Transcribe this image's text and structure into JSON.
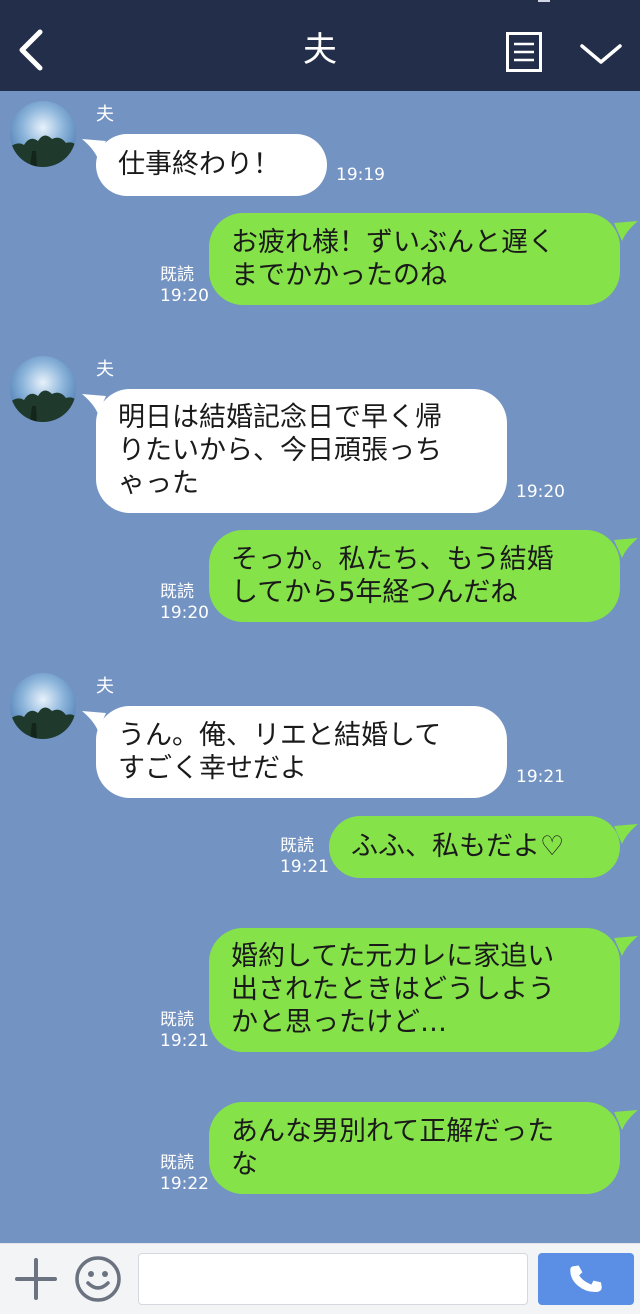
{
  "header": {
    "title": "夫",
    "icons": {
      "back": "chevron-left-icon",
      "menu": "menu-list-icon",
      "more": "chevron-down-icon"
    }
  },
  "contact": {
    "name": "夫",
    "avatar": "avatar-tree-sky-photo"
  },
  "messages": [
    {
      "side": "in",
      "sender": "夫",
      "text": "仕事終わり！",
      "time": "19:19"
    },
    {
      "side": "out",
      "status": "既読",
      "text": "お疲れ様！ずいぶんと遅く\nまでかかったのね",
      "time": "19:20"
    },
    {
      "side": "in",
      "sender": "夫",
      "text": "明日は結婚記念日で早く帰\nりたいから、今日頑張っち\nゃった",
      "time": "19:20"
    },
    {
      "side": "out",
      "status": "既読",
      "text": "そっか。私たち、もう結婚\nしてから5年経つんだね",
      "time": "19:20"
    },
    {
      "side": "in",
      "sender": "夫",
      "text": "うん。俺、リエと結婚して\nすごく幸せだよ",
      "time": "19:21"
    },
    {
      "side": "out",
      "status": "既読",
      "text": "ふふ、私もだよ♡",
      "time": "19:21"
    },
    {
      "side": "out",
      "status": "既読",
      "text": "婚約してた元カレに家追い\n出されたときはどうしよう\nかと思ったけど…",
      "time": "19:21"
    },
    {
      "side": "out",
      "status": "既読",
      "text": "あんな男別れて正解だった\nな",
      "time": "19:22"
    }
  ],
  "input": {
    "value": "",
    "placeholder": "",
    "icons": {
      "add": "plus-icon",
      "sticker": "smiley-icon",
      "call": "phone-icon"
    }
  },
  "colors": {
    "header_bg": "#232f4a",
    "chat_bg": "#7393c2",
    "bubble_in": "#ffffff",
    "bubble_out": "#85e249",
    "call_button": "#5b8fe6"
  }
}
